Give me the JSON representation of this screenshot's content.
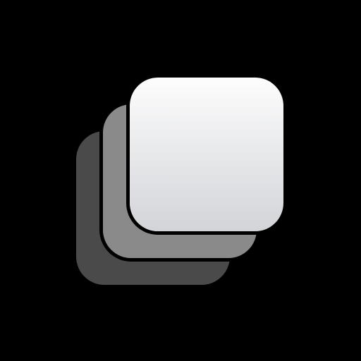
{
  "icon": {
    "name": "stacked-layers-icon",
    "background_color": "#000000",
    "outline_color": "#000000",
    "layers": [
      {
        "id": "back",
        "fill_top": "#4a4a4a",
        "fill_bottom": "#4a4a4a"
      },
      {
        "id": "middle",
        "fill_top": "#8a8a8a",
        "fill_bottom": "#8a8a8a"
      },
      {
        "id": "front",
        "fill_top": "#fdfdfd",
        "fill_bottom": "#d2d4d8"
      }
    ]
  }
}
